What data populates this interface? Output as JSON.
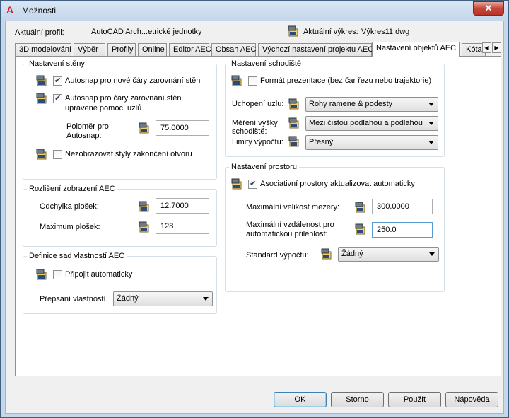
{
  "window": {
    "title": "Možnosti",
    "close_symbol": "✕"
  },
  "profile": {
    "label": "Aktuální profil:",
    "value": "AutoCAD Arch...etrické jednotky"
  },
  "drawing": {
    "label": "Aktuální výkres:",
    "value": "Výkres11.dwg"
  },
  "tabs": [
    "3D modelování",
    "Výběr",
    "Profily",
    "Online",
    "Editor AEC",
    "Obsah AEC",
    "Výchozí nastavení projektu AEC",
    "Nastavení objektů AEC",
    "Kóta"
  ],
  "wall": {
    "title": "Nastavení stěny",
    "autosnap_new": "Autosnap pro nové čáry zarovnání stěn",
    "autosnap_grip_1": "Autosnap pro čáry zarovnání stěn",
    "autosnap_grip_2": "upravené pomocí uzlů",
    "radius_label_1": "Poloměr pro",
    "radius_label_2": "Autosnap:",
    "radius_value": "75.0000",
    "no_endcaps": "Nezobrazovat styly zakončení otvoru"
  },
  "resolution": {
    "title": "Rozlišení zobrazení AEC",
    "facet_dev_label": "Odchylka plošek:",
    "facet_dev_value": "12.7000",
    "facet_max_label": "Maximum plošek:",
    "facet_max_value": "128"
  },
  "propset": {
    "title": "Definice sad vlastností AEC",
    "auto_attach": "Připojit automaticky",
    "override_label": "Přepsání vlastností",
    "override_value": "Žádný"
  },
  "stair": {
    "title": "Nastavení schodiště",
    "presentation": "Formát prezentace (bez čar řezu nebo trajektorie)",
    "node_label": "Uchopení uzlu:",
    "node_value": "Rohy ramene & podesty",
    "height_label_1": "Měření výšky",
    "height_label_2": "schodiště:",
    "height_value": "Mezi čistou podlahou a podlahou",
    "limits_label": "Limity výpočtu:",
    "limits_value": "Přesný"
  },
  "space": {
    "title": "Nastavení prostoru",
    "assoc": "Asociativní prostory aktualizovat automaticky",
    "gap_label": "Maximální velikost mezery:",
    "gap_value": "300.0000",
    "dist_label_1": "Maximální vzdálenost pro",
    "dist_label_2": "automatickou přilehlost:",
    "dist_value": "250.0",
    "std_label": "Standard výpočtu:",
    "std_value": "Žádný"
  },
  "buttons": {
    "ok": "OK",
    "cancel": "Storno",
    "apply": "Použít",
    "help": "Nápověda"
  },
  "icons": {
    "drawing": "drawing-file-icon",
    "app": "autocad-logo-icon"
  }
}
